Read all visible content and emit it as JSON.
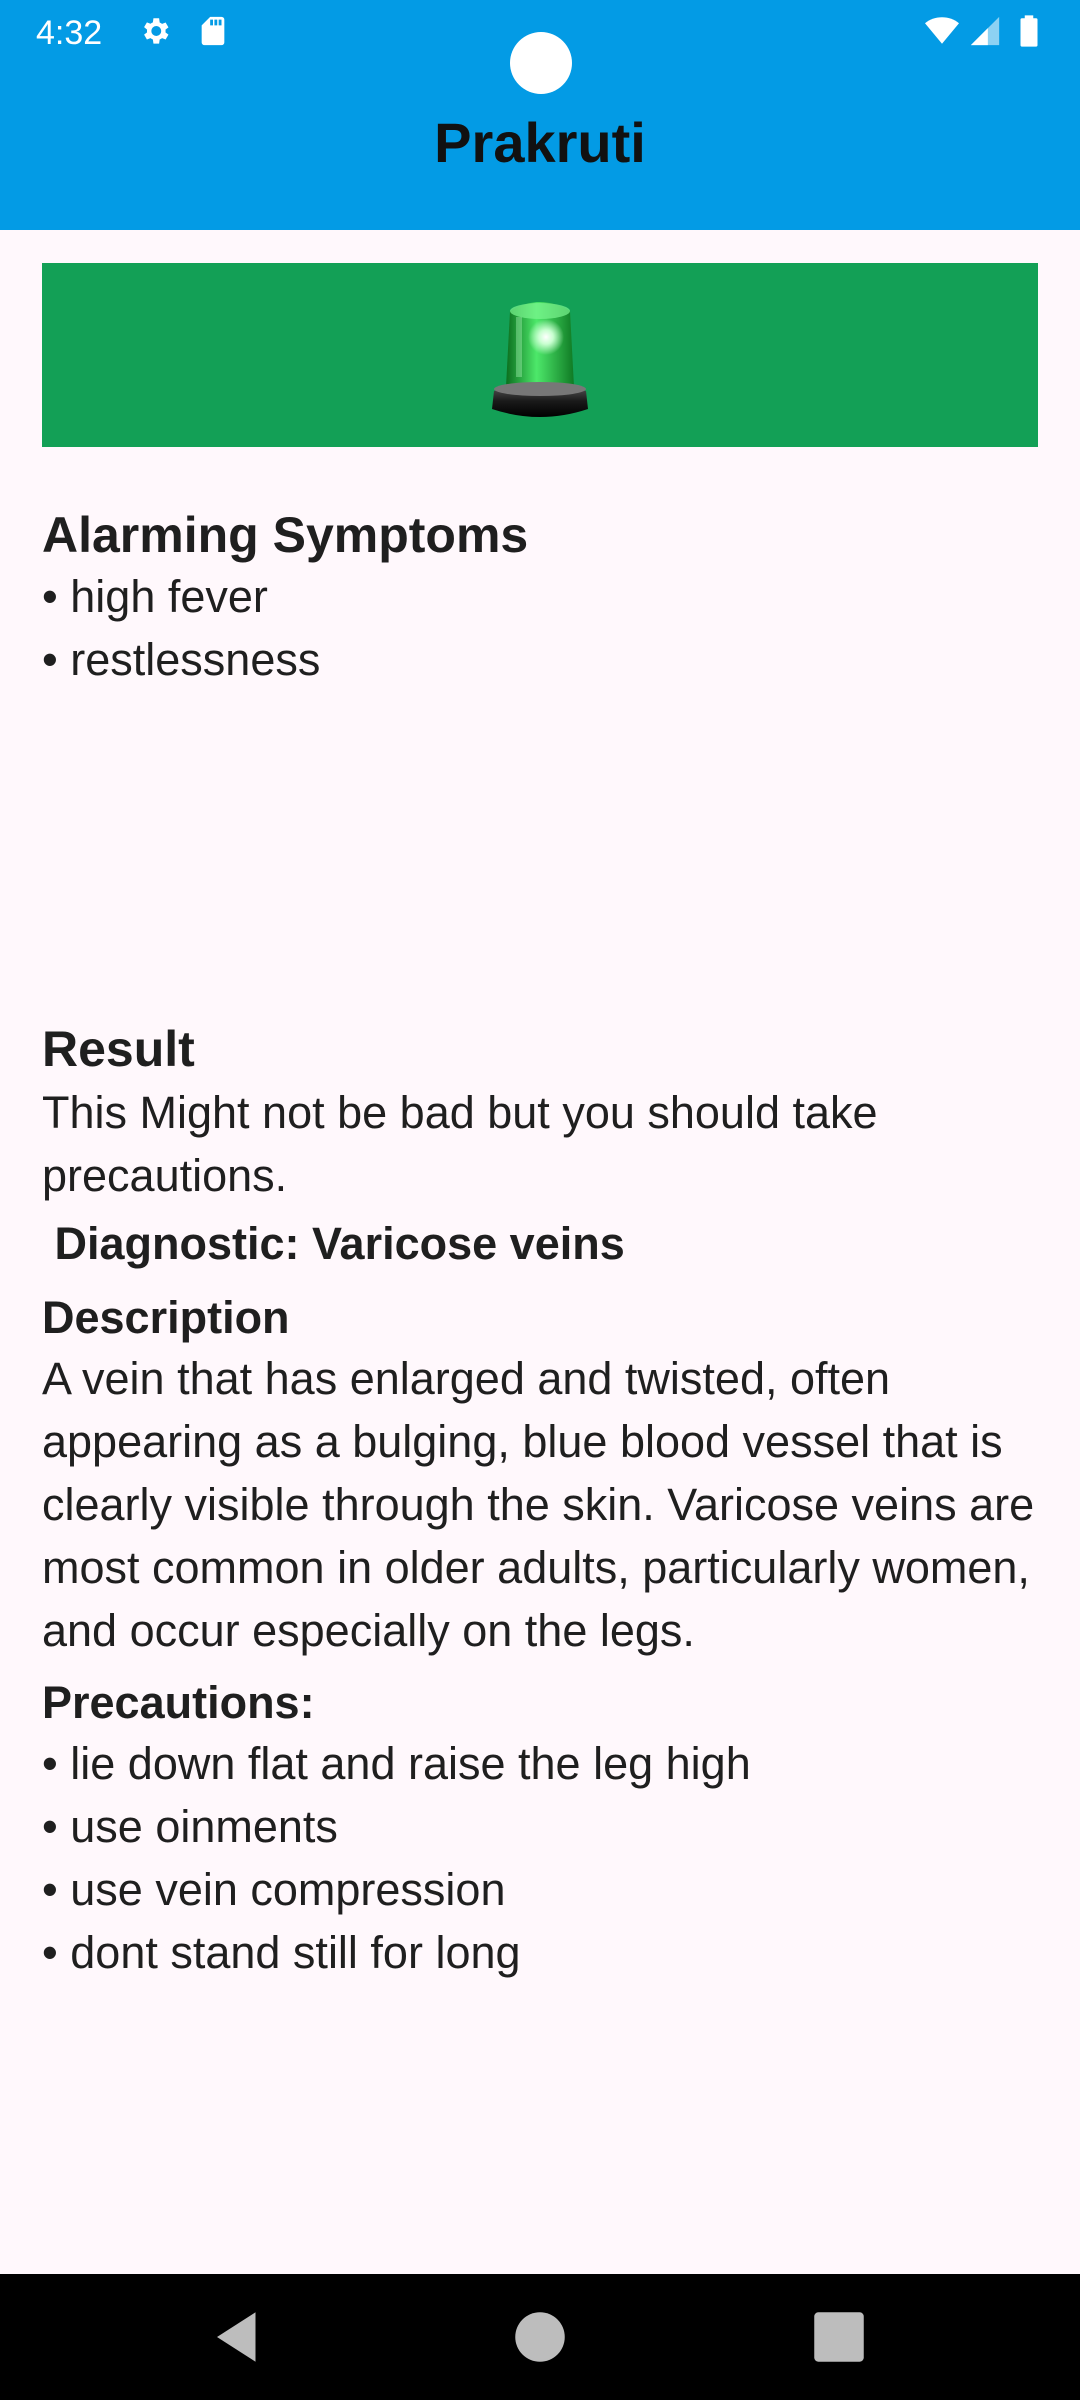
{
  "status_bar": {
    "time": "4:32",
    "icons": [
      "gear-icon",
      "sd-card-icon",
      "wifi-icon",
      "signal-icon",
      "battery-icon"
    ]
  },
  "app": {
    "title": "Prakruti",
    "banner_color": "#13A056",
    "header_color": "#039BE5"
  },
  "alarming": {
    "heading": "Alarming Symptoms",
    "items": [
      "high fever",
      "restlessness"
    ]
  },
  "result": {
    "heading": "Result",
    "text": "This Might not be bad but you should take precautions.",
    "diagnostic": " Diagnostic: Varicose veins",
    "description_heading": "Description",
    "description": "A vein that has enlarged and twisted, often appearing as a bulging, blue blood vessel that is clearly visible through the skin. Varicose veins are most common in older adults, particularly women, and occur especially on the legs.",
    "precautions_heading": "Precautions:",
    "precautions": [
      "lie down flat and raise the leg high",
      "use oinments",
      "use vein compression",
      "dont stand still for long"
    ]
  },
  "nav": {
    "buttons": [
      "back-icon",
      "home-icon",
      "recents-icon"
    ]
  }
}
